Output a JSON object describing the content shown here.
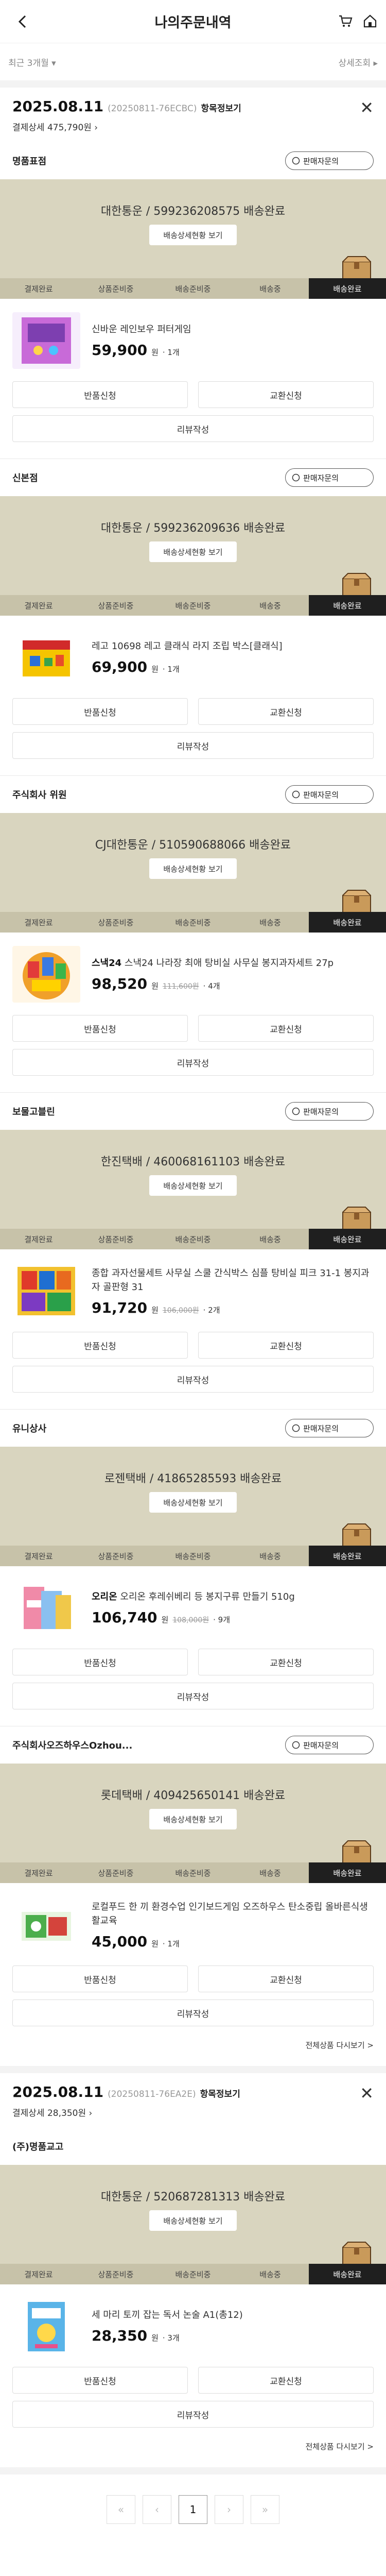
{
  "header": {
    "title": "나의주문내역"
  },
  "filter": {
    "period": "최근 3개월",
    "detail": "상세조회"
  },
  "orders": [
    {
      "date": "2025.08.11",
      "order_no": "(20250811-76ECBC)",
      "detail_label": "항목정보기",
      "payment": "결제상세 475,790원",
      "shipments": [
        {
          "seller": "명품표점",
          "ask": "판매자문의",
          "carrier": "대한통운 / 599236208575 배송완료",
          "detail_btn": "배송상세현황 보기",
          "steps": [
            "결제완료",
            "상품준비중",
            "배송준비중",
            "배송중",
            "배송완료"
          ],
          "product": {
            "name_bold": "",
            "name": "신바운 레인보우 퍼터게임",
            "price": "59,900",
            "unit": "원",
            "orig": "",
            "qty": "1개"
          },
          "buttons": [
            "반품신청",
            "교환신청",
            "리뷰작성"
          ]
        },
        {
          "seller": "신본점",
          "ask": "판매자문의",
          "carrier": "대한통운 / 599236209636 배송완료",
          "detail_btn": "배송상세현황 보기",
          "steps": [
            "결제완료",
            "상품준비중",
            "배송준비중",
            "배송중",
            "배송완료"
          ],
          "product": {
            "name_bold": "",
            "name": "레고 10698 레고 클래식 라지 조립 박스[클래식]",
            "price": "69,900",
            "unit": "원",
            "orig": "",
            "qty": "1개"
          },
          "buttons": [
            "반품신청",
            "교환신청",
            "리뷰작성"
          ]
        },
        {
          "seller": "주식회사 위원",
          "ask": "판매자문의",
          "carrier": "CJ대한통운 / 510590688066 배송완료",
          "detail_btn": "배송상세현황 보기",
          "steps": [
            "결제완료",
            "상품준비중",
            "배송준비중",
            "배송중",
            "배송완료"
          ],
          "product": {
            "name_bold": "스낵24",
            "name": " 스낵24 나라장 최애 탕비실 사무실 봉지과자세트 27p",
            "price": "98,520",
            "unit": "원",
            "orig": "111,600원",
            "qty": "4개"
          },
          "buttons": [
            "반품신청",
            "교환신청",
            "리뷰작성"
          ]
        },
        {
          "seller": "보물고블린",
          "ask": "판매자문의",
          "carrier": "한진택배 / 460068161103 배송완료",
          "detail_btn": "배송상세현황 보기",
          "steps": [
            "결제완료",
            "상품준비중",
            "배송준비중",
            "배송중",
            "배송완료"
          ],
          "product": {
            "name_bold": "",
            "name": "종합 과자선물세트 사무실 스쿨 간식박스 심플 탕비실 피크 31-1 봉지과자 골판형 31",
            "price": "91,720",
            "unit": "원",
            "orig": "106,000원",
            "qty": "2개"
          },
          "buttons": [
            "반품신청",
            "교환신청",
            "리뷰작성"
          ]
        },
        {
          "seller": "유니상사",
          "ask": "판매자문의",
          "carrier": "로젠택배 / 41865285593 배송완료",
          "detail_btn": "배송상세현황 보기",
          "steps": [
            "결제완료",
            "상품준비중",
            "배송준비중",
            "배송중",
            "배송완료"
          ],
          "product": {
            "name_bold": "오리온",
            "name": " 오리온 후레쉬베리 등 봉지구류 만들기 510g",
            "price": "106,740",
            "unit": "원",
            "orig": "108,000원",
            "qty": "9개"
          },
          "buttons": [
            "반품신청",
            "교환신청",
            "리뷰작성"
          ]
        },
        {
          "seller": "주식회사오즈하우스Ozhou...",
          "ask": "판매자문의",
          "carrier": "롯데택배 / 409425650141 배송완료",
          "detail_btn": "배송상세현황 보기",
          "steps": [
            "결제완료",
            "상품준비중",
            "배송준비중",
            "배송중",
            "배송완료"
          ],
          "product": {
            "name_bold": "",
            "name": "로컬푸드 한 끼 환경수업 인기보드게임 오즈하우스 탄소중립 올바른식생활교육",
            "price": "45,000",
            "unit": "원",
            "orig": "",
            "qty": "1개"
          },
          "buttons": [
            "반품신청",
            "교환신청",
            "리뷰작성"
          ]
        }
      ],
      "more": "전체상품 다시보기 >"
    },
    {
      "date": "2025.08.11",
      "order_no": "(20250811-76EA2E)",
      "detail_label": "항목정보기",
      "payment": "결제상세 28,350원",
      "shipments": [
        {
          "seller": "(주)명품교고",
          "ask": "",
          "carrier": "대한통운 / 520687281313 배송완료",
          "detail_btn": "배송상세현황 보기",
          "steps": [
            "결제완료",
            "상품준비중",
            "배송준비중",
            "배송중",
            "배송완료"
          ],
          "product": {
            "name_bold": "",
            "name": "세 마리 토끼 잡는 독서 논술 A1(총12)",
            "price": "28,350",
            "unit": "원",
            "orig": "",
            "qty": "3개"
          },
          "buttons": [
            "반품신청",
            "교환신청",
            "리뷰작성"
          ]
        }
      ],
      "more": "전체상품 다시보기 >"
    }
  ],
  "pager": {
    "prev": "«",
    "prev1": "‹",
    "current": "1",
    "next1": "›",
    "next": "»"
  },
  "colors": {
    "track_bg": "#d9d5bf",
    "step_bg": "#c7c2a9",
    "step_active": "#1f1f1f"
  }
}
